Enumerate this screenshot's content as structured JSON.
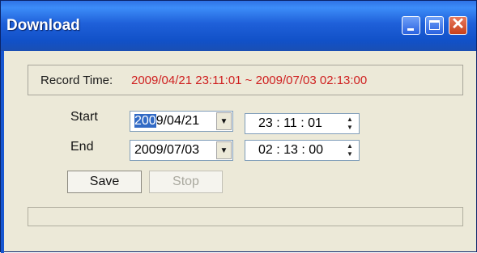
{
  "window": {
    "title": "Download"
  },
  "record": {
    "label": "Record Time:",
    "value": "2009/04/21 23:11:01 ~ 2009/07/03 02:13:00"
  },
  "start": {
    "label": "Start",
    "date_selected": "200",
    "date_cursor_char": "9",
    "date_rest": "/04/21",
    "time": "23 : 11 : 01"
  },
  "end": {
    "label": "End",
    "date": "2009/07/03",
    "time": "02 : 13 : 00"
  },
  "buttons": {
    "save": "Save",
    "stop": "Stop"
  },
  "progress": {
    "value": 0
  },
  "colors": {
    "record_value": "#cf1f1f",
    "title_bar": "#1f60d9",
    "close_button": "#c8411b"
  },
  "icons": [
    "minimize-icon",
    "maximize-icon",
    "close-icon",
    "dropdown-arrow-icon",
    "spin-up-icon",
    "spin-down-icon"
  ]
}
